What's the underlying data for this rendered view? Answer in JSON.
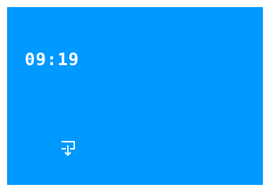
{
  "screen": {
    "background_color": "#0099ff"
  },
  "clock": {
    "time": "09:19",
    "color": "#ffffff"
  },
  "download": {
    "icon": "download-tray-icon"
  }
}
